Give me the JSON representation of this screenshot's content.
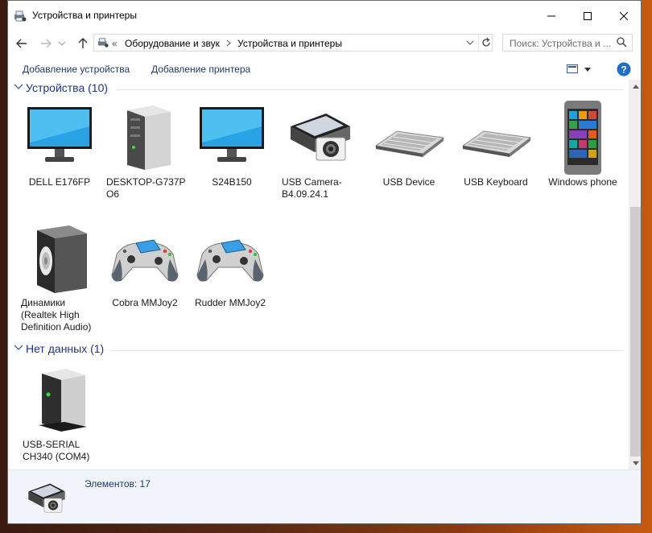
{
  "window": {
    "title": "Устройства и принтеры"
  },
  "address": {
    "sep": "«",
    "crumbs": [
      "Оборудование и звук",
      "Устройства и принтеры"
    ]
  },
  "search": {
    "placeholder": "Поиск: Устройства и ..."
  },
  "commands": {
    "add_device": "Добавление устройства",
    "add_printer": "Добавление принтера"
  },
  "groups": [
    {
      "title": "Устройства (10)",
      "items": [
        {
          "label": "DELL E176FP",
          "icon": "monitor-icon"
        },
        {
          "label": "DESKTOP-G737P O6",
          "icon": "computer-tower-icon"
        },
        {
          "label": "S24B150",
          "icon": "monitor-icon"
        },
        {
          "label": "USB Camera-B4.09.24.1",
          "icon": "camera-scanner-icon"
        },
        {
          "label": "USB Device",
          "icon": "keyboard-icon"
        },
        {
          "label": "USB Keyboard",
          "icon": "keyboard-icon"
        },
        {
          "label": "Windows phone",
          "icon": "phone-icon"
        },
        {
          "label": "Динамики (Realtek High Definition Audio)",
          "icon": "speaker-icon"
        },
        {
          "label": "Cobra MMJoy2",
          "icon": "gamepad-icon"
        },
        {
          "label": "Rudder MMJoy2",
          "icon": "gamepad-icon"
        }
      ]
    },
    {
      "title": "Нет данных (1)",
      "items": [
        {
          "label": "USB-SERIAL CH340 (COM4)",
          "icon": "generic-device-icon"
        }
      ]
    }
  ],
  "details": {
    "count": "Элементов: 17",
    "icon": "camera-scanner-icon"
  }
}
